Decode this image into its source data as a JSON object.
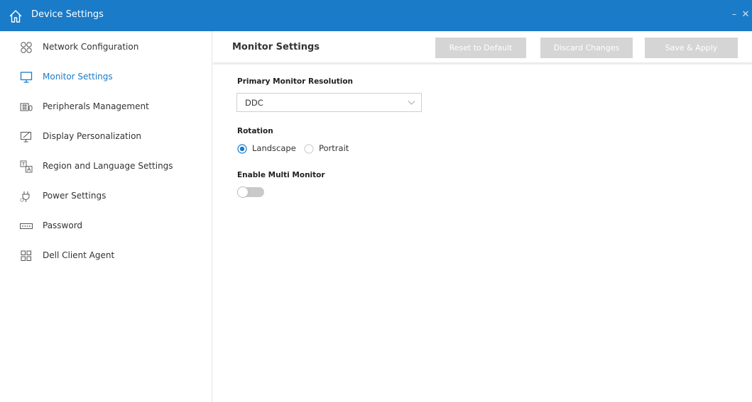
{
  "window": {
    "title": "Device Settings",
    "minimize_glyph": "–",
    "close_glyph": "✕"
  },
  "sidebar": {
    "items": [
      {
        "label": "Network Configuration",
        "icon": "network-icon",
        "active": false
      },
      {
        "label": "Monitor Settings",
        "icon": "monitor-icon",
        "active": true
      },
      {
        "label": "Peripherals Management",
        "icon": "keyboard-icon",
        "active": false
      },
      {
        "label": "Display Personalization",
        "icon": "display-pen-icon",
        "active": false
      },
      {
        "label": "Region and Language Settings",
        "icon": "language-icon",
        "active": false
      },
      {
        "label": "Power Settings",
        "icon": "power-plug-icon",
        "active": false
      },
      {
        "label": "Password",
        "icon": "password-icon",
        "active": false
      },
      {
        "label": "Dell Client Agent",
        "icon": "agent-grid-icon",
        "active": false
      }
    ]
  },
  "main": {
    "title": "Monitor Settings",
    "buttons": {
      "reset": "Reset to Default",
      "discard": "Discard Changes",
      "save": "Save & Apply"
    },
    "resolution": {
      "label": "Primary Monitor Resolution",
      "value": "DDC"
    },
    "rotation": {
      "label": "Rotation",
      "options": [
        {
          "label": "Landscape",
          "selected": true
        },
        {
          "label": "Portrait",
          "selected": false
        }
      ]
    },
    "multi_monitor": {
      "label": "Enable Multi Monitor",
      "enabled": false
    }
  },
  "colors": {
    "accent": "#1a7bc8",
    "button_disabled": "#d5d5d5",
    "toggle_off": "#c9c9c9"
  }
}
